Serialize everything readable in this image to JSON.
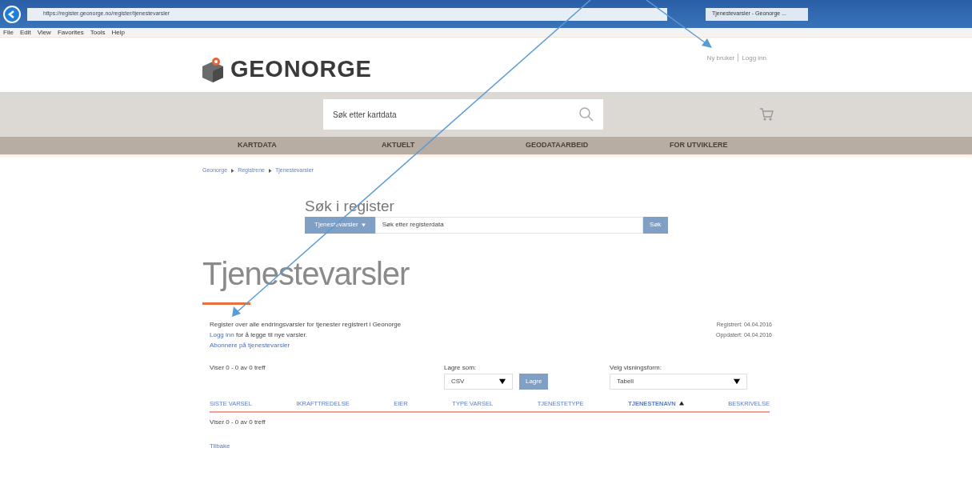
{
  "browser": {
    "address": "https://register.geonorge.no/register/tjenestevarsler",
    "tab_title": "Tjenestevarsler - Geonorge ...",
    "menu": [
      "File",
      "Edit",
      "View",
      "Favorites",
      "Tools",
      "Help"
    ]
  },
  "header": {
    "logo_text": "GEONORGE",
    "user_links": [
      "Ny bruker",
      "Logg inn"
    ],
    "search": {
      "placeholder": "Søk etter kartdata"
    }
  },
  "nav": [
    "KARTDATA",
    "AKTUELT",
    "GEODATAARBEID",
    "FOR UTVIKLERE"
  ],
  "breadcrumb": [
    "Geonorge",
    "Registrene",
    "Tjenestevarsler"
  ],
  "register_search": {
    "heading": "Søk i register",
    "filter": "Tjenestevarsler",
    "placeholder": "Søk etter registerdata",
    "button": "Søk"
  },
  "page": {
    "title": "Tjenestevarsler",
    "description": "Register over alle endringsvarsler for tjenester registrert i Geonorge",
    "login_link": "Logg inn",
    "login_text": " for å legge til nye varsler.",
    "subscribe_link": "Abonnere på tjenestevarsler",
    "registered": "Registrert: 04.04.2016",
    "updated": "Oppdatert: 04.04.2016"
  },
  "toolbar": {
    "count": "Viser 0 - 0 av 0 treff",
    "save_label": "Lagre som:",
    "save_format": "CSV",
    "save_button": "Lagre",
    "view_label": "Velg visningsform:",
    "view_value": "Tabell"
  },
  "table": {
    "columns": [
      {
        "label": "SISTE VARSEL",
        "sorted": false
      },
      {
        "label": "IKRAFTTREDELSE",
        "sorted": false
      },
      {
        "label": "EIER",
        "sorted": false
      },
      {
        "label": "TYPE VARSEL",
        "sorted": false
      },
      {
        "label": "TJENESTETYPE",
        "sorted": false
      },
      {
        "label": "TJENESTENAVN",
        "sorted": true
      },
      {
        "label": "BESKRIVELSE",
        "sorted": false
      }
    ]
  },
  "footer_count": "Viser 0 - 0 av 0 treff",
  "back_link": "Tilbake"
}
